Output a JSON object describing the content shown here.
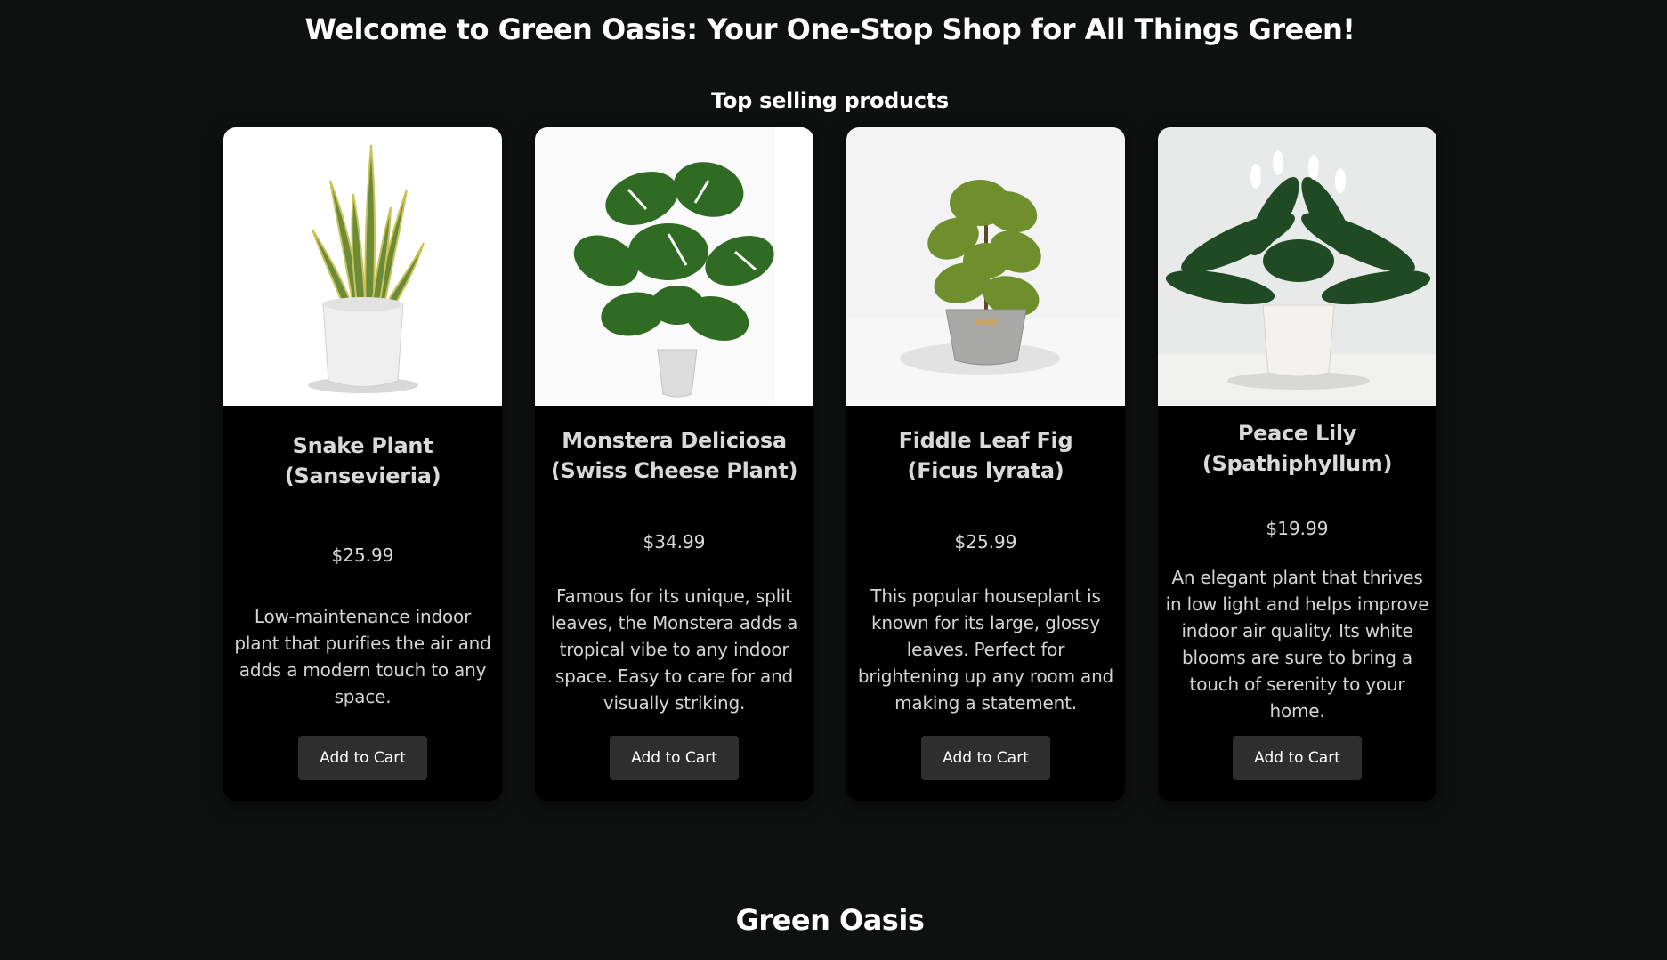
{
  "header": {
    "title": "Welcome to Green Oasis: Your One-Stop Shop for All Things Green!"
  },
  "products_section": {
    "title": "Top selling products",
    "products": [
      {
        "name_line1": "Snake Plant",
        "name_line2": "(Sansevieria)",
        "price": "$25.99",
        "description": "Low-maintenance indoor plant that purifies the air and adds a modern touch to any space.",
        "button_label": "Add to Cart"
      },
      {
        "name_line1": "Monstera Deliciosa",
        "name_line2": "(Swiss Cheese Plant)",
        "price": "$34.99",
        "description": "Famous for its unique, split leaves, the Monstera adds a tropical vibe to any indoor space. Easy to care for and visually striking.",
        "button_label": "Add to Cart"
      },
      {
        "name_line1": "Fiddle Leaf Fig",
        "name_line2": "(Ficus lyrata)",
        "price": "$25.99",
        "description": "This popular houseplant is known for its large, glossy leaves. Perfect for brightening up any room and making a statement.",
        "button_label": "Add to Cart"
      },
      {
        "name_line1": "Peace Lily",
        "name_line2": "(Spathiphyllum)",
        "price": "$19.99",
        "description": "An elegant plant that thrives in low light and helps improve indoor air quality. Its white blooms are sure to bring a touch of serenity to your home.",
        "button_label": "Add to Cart"
      }
    ]
  },
  "footer": {
    "title": "Green Oasis"
  },
  "colors": {
    "page_background": "#0f1010",
    "card_background": "#000000",
    "button_background": "#2e2e2e"
  }
}
